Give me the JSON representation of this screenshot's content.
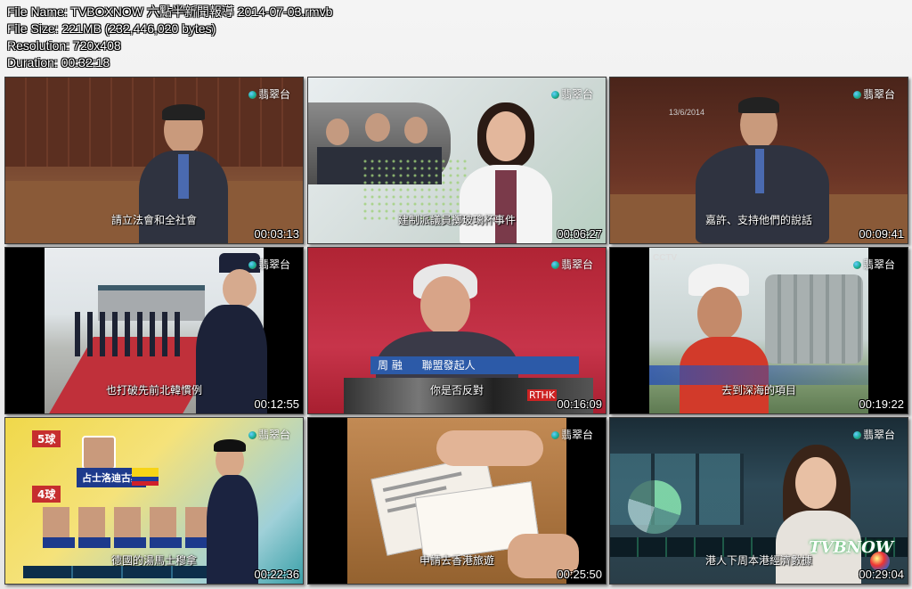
{
  "info": {
    "file_name": "File Name: TVBOXNOW 六點半新聞報導 2014-07-03.rmvb",
    "file_size": "File Size: 221MB (232,446,020 bytes)",
    "resolution": "Resolution: 720x408",
    "duration": "Duration: 00:32:18"
  },
  "channel_logo": "翡翠台",
  "thumbnails": [
    {
      "subtitle": "請立法會和全社會",
      "timestamp": "00:03:13"
    },
    {
      "subtitle": "建制派議員擲玻璃杯事件",
      "timestamp": "00:06:27"
    },
    {
      "subtitle": "嘉許、支持他們的說話",
      "timestamp": "00:09:41",
      "date_stamp": "13/6/2014"
    },
    {
      "subtitle": "也打破先前北韓慣例",
      "timestamp": "00:12:55"
    },
    {
      "subtitle": "你是否反對",
      "timestamp": "00:16:09",
      "caption_name": "周 融",
      "caption_role": "聯盟發起人",
      "mic_label": "RTHK"
    },
    {
      "subtitle": "去到深海的項目",
      "timestamp": "00:19:22",
      "cctv": "CCTV"
    },
    {
      "subtitle": "德國的湯馬士穆拿",
      "timestamp": "00:22:36",
      "label_5": "5球",
      "label_4": "4球",
      "player": "占士洛迪古斯"
    },
    {
      "subtitle": "申請去香港旅遊",
      "timestamp": "00:25:50"
    },
    {
      "subtitle": "港人下周本港經濟數據",
      "timestamp": "00:29:04",
      "watermark": "TVBNOW"
    }
  ]
}
